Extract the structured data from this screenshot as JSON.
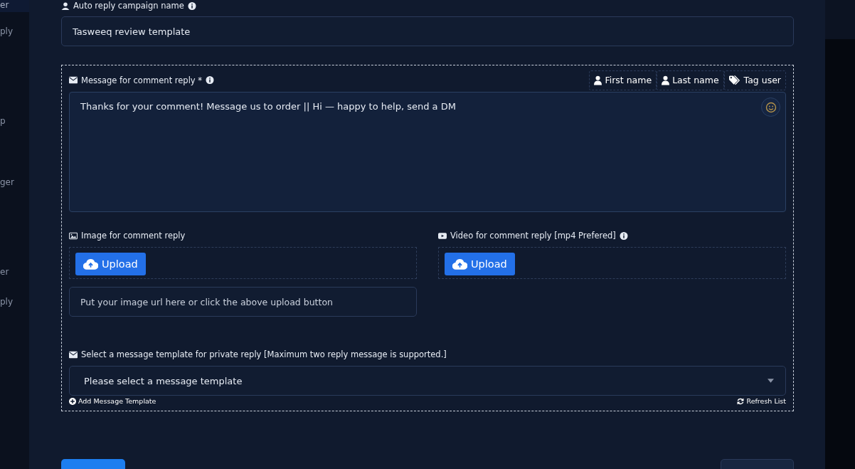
{
  "sidebar": {
    "items": [
      {
        "label": "er",
        "selected": true
      },
      {
        "label": "ply",
        "selected": false
      },
      {
        "label": "p",
        "selected": false
      },
      {
        "label": "ger",
        "selected": false
      },
      {
        "label": "er",
        "selected": false
      },
      {
        "label": "ply",
        "selected": false
      }
    ]
  },
  "form": {
    "campaign_name": {
      "label": "Auto reply campaign name",
      "value": "Tasweeq review template"
    },
    "message": {
      "label": "Message for comment reply *",
      "value": "Thanks for your comment! Message us to order || Hi — happy to help, send a DM",
      "insert_buttons": [
        {
          "kind": "person",
          "label": "First name"
        },
        {
          "kind": "person",
          "label": "Last name"
        },
        {
          "kind": "tag",
          "label": "Tag user"
        }
      ]
    },
    "image": {
      "label": "Image for comment reply",
      "upload_button": "Upload",
      "url_placeholder": "Put your image url here or click the above upload button"
    },
    "video": {
      "label": "Video for comment reply [mp4 Prefered]",
      "upload_button": "Upload"
    },
    "template": {
      "label": "Select a message template for private reply [Maximum two reply message is supported.]",
      "placeholder": "Please select a message template",
      "add_link": "Add Message Template",
      "refresh_link": "Refresh List"
    }
  }
}
